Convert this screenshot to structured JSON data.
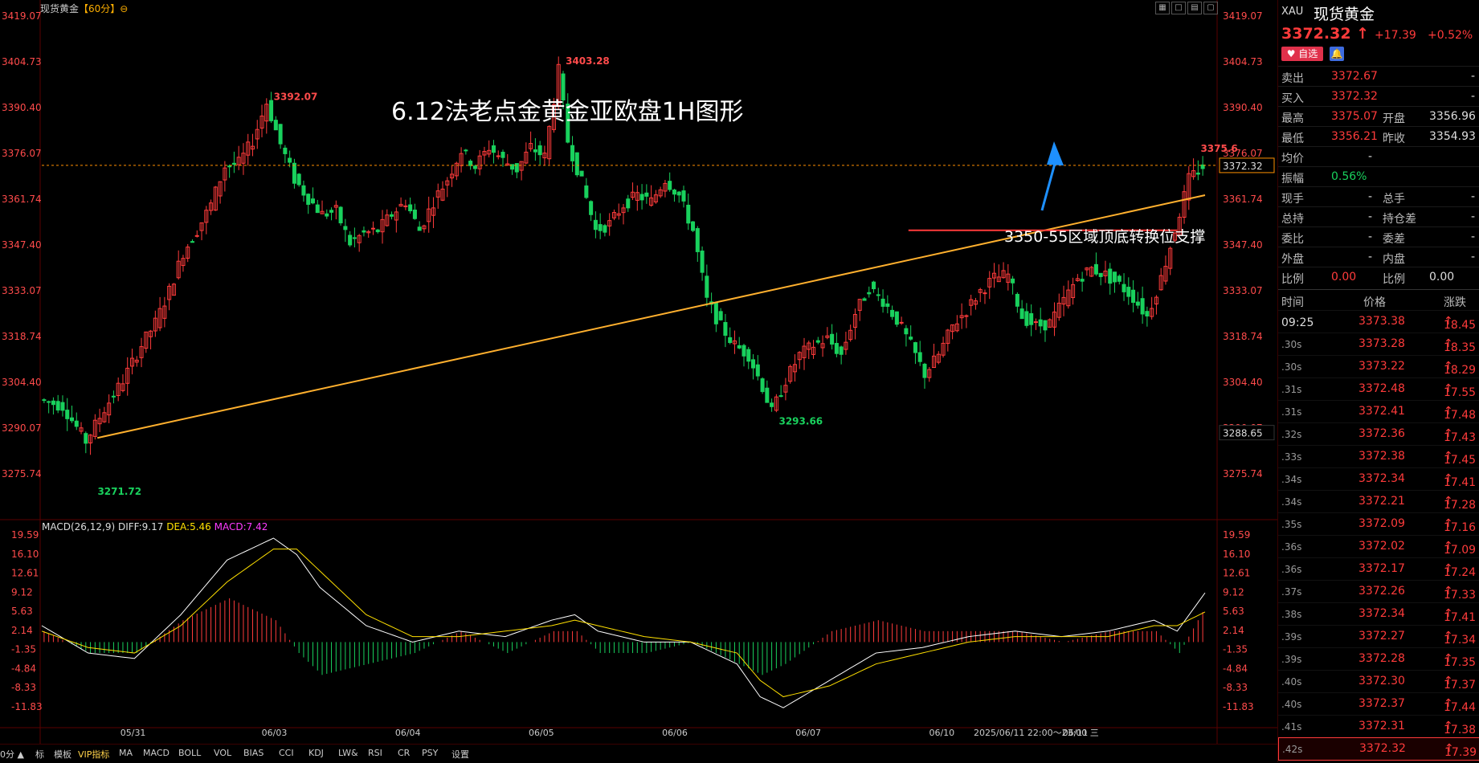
{
  "header": {
    "instrument": "现货黄金",
    "period": "【60分】",
    "period_icon": "⊖"
  },
  "annotations": {
    "title": "6.12法老点金黄金亚欧盘1H图形",
    "support": "3350-55区域顶底转换位支撑"
  },
  "chart_data": [
    {
      "type": "candlestick",
      "title": "现货黄金【60分】",
      "ylim": [
        3271.72,
        3419.07
      ],
      "y_ticks": [
        "3419.07",
        "3404.73",
        "3390.40",
        "3376.07",
        "3361.74",
        "3347.40",
        "3333.07",
        "3318.74",
        "3304.40",
        "3290.07",
        "3275.74"
      ],
      "x_labels": [
        "05/31",
        "06/03",
        "06/04",
        "06/05",
        "06/06",
        "06/07",
        "06/10",
        "06/11"
      ],
      "current_price_label": "3372.32",
      "low_marker_label": "3288.65",
      "value_labels": [
        {
          "text": "3392.07",
          "type": "high"
        },
        {
          "text": "3403.28",
          "type": "high"
        },
        {
          "text": "3375.6",
          "type": "high"
        },
        {
          "text": "3271.72",
          "type": "low"
        },
        {
          "text": "3293.66",
          "type": "low"
        }
      ],
      "cursor_time": "2025/06/11 22:00～23:00 三",
      "series": [
        {
          "name": "price",
          "points": [
            [
              0,
              3299
            ],
            [
              5,
              3297
            ],
            [
              10,
              3286
            ],
            [
              14,
              3296
            ],
            [
              18,
              3305
            ],
            [
              22,
              3316
            ],
            [
              25,
              3323
            ],
            [
              28,
              3333
            ],
            [
              31,
              3345
            ],
            [
              34,
              3352
            ],
            [
              37,
              3360
            ],
            [
              40,
              3372
            ],
            [
              43,
              3373
            ],
            [
              46,
              3380
            ],
            [
              49,
              3392
            ],
            [
              52,
              3379
            ],
            [
              55,
              3368
            ],
            [
              58,
              3362
            ],
            [
              61,
              3357
            ],
            [
              64,
              3358
            ],
            [
              67,
              3348
            ],
            [
              70,
              3351
            ],
            [
              73,
              3352
            ],
            [
              76,
              3357
            ],
            [
              79,
              3361
            ],
            [
              82,
              3352
            ],
            [
              85,
              3361
            ],
            [
              88,
              3368
            ],
            [
              91,
              3377
            ],
            [
              94,
              3372
            ],
            [
              97,
              3378
            ],
            [
              100,
              3374
            ],
            [
              103,
              3371
            ],
            [
              106,
              3378
            ],
            [
              109,
              3375
            ],
            [
              112,
              3402
            ],
            [
              114,
              3380
            ],
            [
              117,
              3367
            ],
            [
              120,
              3352
            ],
            [
              123,
              3354
            ],
            [
              126,
              3360
            ],
            [
              129,
              3363
            ],
            [
              132,
              3361
            ],
            [
              135,
              3368
            ],
            [
              138,
              3363
            ],
            [
              141,
              3352
            ],
            [
              144,
              3330
            ],
            [
              147,
              3322
            ],
            [
              150,
              3316
            ],
            [
              153,
              3313
            ],
            [
              156,
              3303
            ],
            [
              158,
              3295
            ],
            [
              161,
              3305
            ],
            [
              164,
              3313
            ],
            [
              167,
              3316
            ],
            [
              170,
              3318
            ],
            [
              173,
              3313
            ],
            [
              176,
              3326
            ],
            [
              179,
              3334
            ],
            [
              182,
              3330
            ],
            [
              185,
              3324
            ],
            [
              188,
              3316
            ],
            [
              191,
              3307
            ],
            [
              194,
              3313
            ],
            [
              197,
              3322
            ],
            [
              200,
              3327
            ],
            [
              203,
              3333
            ],
            [
              206,
              3337
            ],
            [
              209,
              3338
            ],
            [
              212,
              3325
            ],
            [
              215,
              3322
            ],
            [
              218,
              3323
            ],
            [
              221,
              3330
            ],
            [
              224,
              3337
            ],
            [
              227,
              3340
            ],
            [
              230,
              3338
            ],
            [
              233,
              3335
            ],
            [
              236,
              3331
            ],
            [
              239,
              3325
            ],
            [
              242,
              3337
            ],
            [
              245,
              3352
            ],
            [
              248,
              3368
            ],
            [
              251,
              3372
            ]
          ]
        }
      ],
      "lines": [
        {
          "name": "trendline",
          "color": "#ffb02e"
        },
        {
          "name": "support",
          "color": "#ff3b3b"
        },
        {
          "name": "current-price",
          "color": "#ff9000"
        }
      ]
    },
    {
      "type": "macd",
      "title": "MACD(26,12,9)",
      "diff_label": "DIFF:9.17",
      "dea_label": "DEA:5.46",
      "macd_label": "MACD:7.42",
      "ylim": [
        -11.83,
        19.59
      ],
      "y_ticks": [
        "19.59",
        "16.10",
        "12.61",
        "9.12",
        "5.63",
        "2.14",
        "-1.35",
        "-4.84",
        "-8.33",
        "-11.83"
      ],
      "series": [
        {
          "name": "DIFF",
          "color": "#ffffff",
          "points": [
            [
              0,
              3
            ],
            [
              10,
              -2
            ],
            [
              20,
              -3
            ],
            [
              30,
              5
            ],
            [
              40,
              15
            ],
            [
              50,
              19
            ],
            [
              55,
              16
            ],
            [
              60,
              10
            ],
            [
              70,
              3
            ],
            [
              80,
              0
            ],
            [
              90,
              2
            ],
            [
              100,
              1
            ],
            [
              110,
              4
            ],
            [
              115,
              5
            ],
            [
              120,
              2
            ],
            [
              130,
              0
            ],
            [
              140,
              0
            ],
            [
              150,
              -4
            ],
            [
              155,
              -10
            ],
            [
              160,
              -12
            ],
            [
              170,
              -7
            ],
            [
              180,
              -2
            ],
            [
              190,
              -1
            ],
            [
              200,
              1
            ],
            [
              210,
              2
            ],
            [
              220,
              1
            ],
            [
              230,
              2
            ],
            [
              240,
              4
            ],
            [
              245,
              2
            ],
            [
              251,
              9
            ]
          ]
        },
        {
          "name": "DEA",
          "color": "#ffe000",
          "points": [
            [
              0,
              2
            ],
            [
              10,
              -1
            ],
            [
              20,
              -2
            ],
            [
              30,
              3
            ],
            [
              40,
              11
            ],
            [
              50,
              17
            ],
            [
              55,
              17
            ],
            [
              60,
              13
            ],
            [
              70,
              5
            ],
            [
              80,
              1
            ],
            [
              90,
              1
            ],
            [
              100,
              2
            ],
            [
              110,
              3
            ],
            [
              115,
              4
            ],
            [
              120,
              3
            ],
            [
              130,
              1
            ],
            [
              140,
              0
            ],
            [
              150,
              -2
            ],
            [
              155,
              -7
            ],
            [
              160,
              -10
            ],
            [
              170,
              -8
            ],
            [
              180,
              -4
            ],
            [
              190,
              -2
            ],
            [
              200,
              0
            ],
            [
              210,
              1
            ],
            [
              220,
              1
            ],
            [
              230,
              1
            ],
            [
              240,
              3
            ],
            [
              245,
              3
            ],
            [
              251,
              5.5
            ]
          ]
        }
      ]
    }
  ],
  "quote": {
    "code": "XAU",
    "name": "现货黄金",
    "price": "3372.32",
    "arrow": "↑",
    "change": "+17.39",
    "change_pct": "+0.52%",
    "fav_label": "♥ 自选",
    "bell_icon": "🔔",
    "rows": [
      {
        "l1": "卖出",
        "v1": "3372.67",
        "l2": "",
        "v2": "-"
      },
      {
        "l1": "买入",
        "v1": "3372.32",
        "l2": "",
        "v2": "-"
      },
      {
        "l1": "最高",
        "v1": "3375.07",
        "l2": "开盘",
        "v2": "3356.96"
      },
      {
        "l1": "最低",
        "v1": "3356.21",
        "l2": "昨收",
        "v2": "3354.93"
      },
      {
        "l1": "均价",
        "v1": "-",
        "l2": "",
        "v2": ""
      },
      {
        "l1": "振幅",
        "v1": "0.56%",
        "l2": "",
        "v2": ""
      },
      {
        "l1": "现手",
        "v1": "-",
        "l2": "总手",
        "v2": "-"
      },
      {
        "l1": "总持",
        "v1": "-",
        "l2": "持仓差",
        "v2": "-"
      },
      {
        "l1": "委比",
        "v1": "-",
        "l2": "委差",
        "v2": "-"
      },
      {
        "l1": "外盘",
        "v1": "-",
        "l2": "内盘",
        "v2": "-"
      },
      {
        "l1": "比例",
        "v1": "0.00",
        "l2": "比例",
        "v2": "0.00"
      }
    ],
    "ticks_header": {
      "time": "时间",
      "price": "价格",
      "chg": "涨跌"
    },
    "ticks": [
      {
        "time": "09:25",
        "price": "3373.38",
        "chg": "18.45"
      },
      {
        "time": ".30s",
        "price": "3373.28",
        "chg": "18.35"
      },
      {
        "time": ".30s",
        "price": "3373.22",
        "chg": "18.29"
      },
      {
        "time": ".31s",
        "price": "3372.48",
        "chg": "17.55"
      },
      {
        "time": ".31s",
        "price": "3372.41",
        "chg": "17.48"
      },
      {
        "time": ".32s",
        "price": "3372.36",
        "chg": "17.43"
      },
      {
        "time": ".33s",
        "price": "3372.38",
        "chg": "17.45"
      },
      {
        "time": ".34s",
        "price": "3372.34",
        "chg": "17.41"
      },
      {
        "time": ".34s",
        "price": "3372.21",
        "chg": "17.28"
      },
      {
        "time": ".35s",
        "price": "3372.09",
        "chg": "17.16"
      },
      {
        "time": ".36s",
        "price": "3372.02",
        "chg": "17.09"
      },
      {
        "time": ".36s",
        "price": "3372.17",
        "chg": "17.24"
      },
      {
        "time": ".37s",
        "price": "3372.26",
        "chg": "17.33"
      },
      {
        "time": ".38s",
        "price": "3372.34",
        "chg": "17.41"
      },
      {
        "time": ".39s",
        "price": "3372.27",
        "chg": "17.34"
      },
      {
        "time": ".39s",
        "price": "3372.28",
        "chg": "17.35"
      },
      {
        "time": ".40s",
        "price": "3372.30",
        "chg": "17.37"
      },
      {
        "time": ".40s",
        "price": "3372.37",
        "chg": "17.44"
      },
      {
        "time": ".41s",
        "price": "3372.31",
        "chg": "17.38"
      },
      {
        "time": ".42s",
        "price": "3372.32",
        "chg": "17.39"
      }
    ]
  },
  "toolbar": {
    "items": [
      "0分 ▲",
      "标",
      "模板",
      "VIP指标",
      "MA",
      "MACD",
      "BOLL",
      "VOL",
      "BIAS",
      "CCI",
      "KDJ",
      "LW&",
      "RSI",
      "CR",
      "PSY",
      "设置"
    ]
  },
  "colors": {
    "up": "#ff3b3b",
    "down": "#19d15d",
    "trend": "#ffb02e",
    "arrow": "#1e90ff"
  }
}
